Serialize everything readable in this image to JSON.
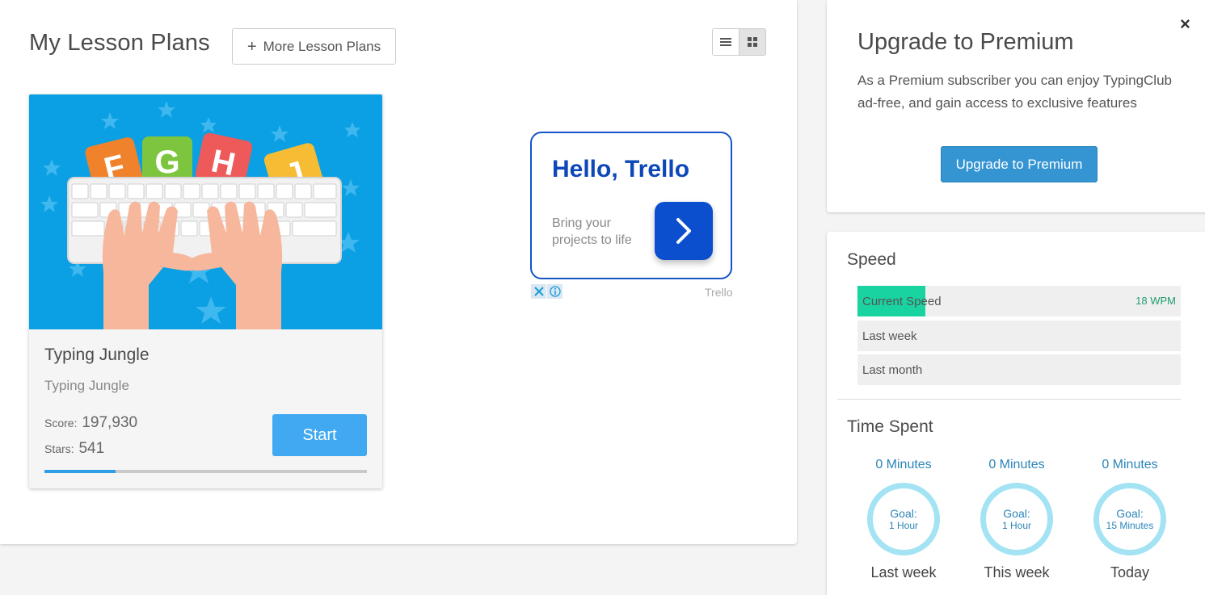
{
  "lessons": {
    "title": "My Lesson Plans",
    "more_label": "More Lesson Plans"
  },
  "card": {
    "image_letters": [
      "F",
      "G",
      "H",
      "J"
    ],
    "title": "Typing Jungle",
    "subtitle": "Typing Jungle",
    "score_label": "Score:",
    "score_value": "197,930",
    "stars_label": "Stars:",
    "stars_value": "541",
    "start_label": "Start",
    "progress_fraction": 0.22
  },
  "ad": {
    "title": "Hello, Trello",
    "text": "Bring your projects to life",
    "brand": "Trello"
  },
  "premium": {
    "close_glyph": "×",
    "title": "Upgrade to Premium",
    "description": "As a Premium subscriber you can enjoy TypingClub ad-free, and gain access to exclusive features",
    "button_label": "Upgrade to Premium"
  },
  "speed": {
    "title": "Speed",
    "rows": [
      {
        "label": "Current Speed",
        "value": "18 WPM",
        "fill_fraction": 0.21
      },
      {
        "label": "Last week",
        "value": ""
      },
      {
        "label": "Last month",
        "value": ""
      }
    ]
  },
  "time": {
    "title": "Time Spent",
    "items": [
      {
        "minutes": "0 Minutes",
        "goal_label": "Goal:",
        "goal": "1 Hour",
        "period": "Last week"
      },
      {
        "minutes": "0 Minutes",
        "goal_label": "Goal:",
        "goal": "1 Hour",
        "period": "This week"
      },
      {
        "minutes": "0 Minutes",
        "goal_label": "Goal:",
        "goal": "15 Minutes",
        "period": "Today"
      }
    ]
  },
  "colors": {
    "accent_blue": "#40a9f2",
    "premium_button": "#3595d3",
    "speed_fill": "#19d3a0",
    "goal_ring": "#a3e3f4",
    "ad_blue": "#0b4fcf"
  }
}
